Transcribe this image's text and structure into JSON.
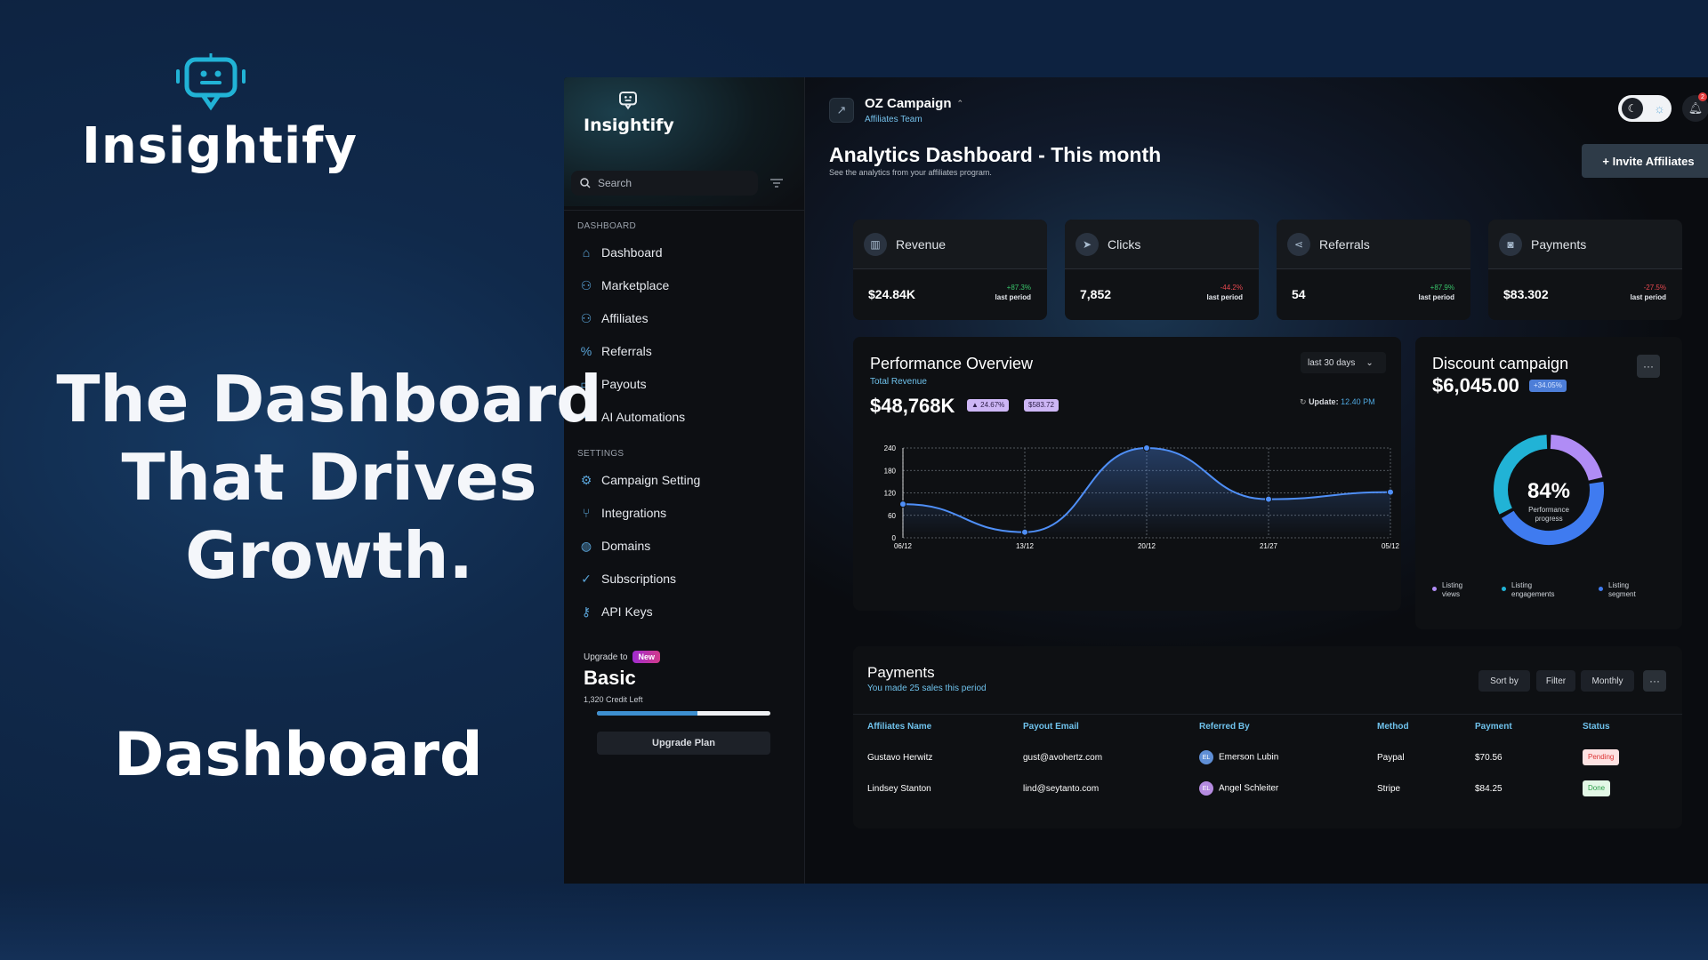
{
  "marketing": {
    "brand_name": "Insightify",
    "headline_line1": "The Dashboard",
    "headline_line2": "That Drives Growth.",
    "subtitle": "Dashboard"
  },
  "colors": {
    "accent": "#4f8ff7",
    "teal": "#21b3d6",
    "purple": "#b08cf5",
    "positive": "#39c46a",
    "negative": "#e8484f"
  },
  "sidebar": {
    "logo_name": "Insightify",
    "search_placeholder": "Search",
    "section_dashboard": "DASHBOARD",
    "section_settings": "SETTINGS",
    "items": [
      {
        "label": "Dashboard",
        "icon": "home-icon"
      },
      {
        "label": "Marketplace",
        "icon": "users-icon"
      },
      {
        "label": "Affiliates",
        "icon": "users-icon"
      },
      {
        "label": "Referrals",
        "icon": "percent-icon"
      },
      {
        "label": "Payouts",
        "icon": "card-icon"
      },
      {
        "label": "AI Automations",
        "icon": "sparkle-icon"
      }
    ],
    "settings_items": [
      {
        "label": "Campaign Setting",
        "icon": "gear-icon"
      },
      {
        "label": "Integrations",
        "icon": "branch-icon"
      },
      {
        "label": "Domains",
        "icon": "globe-icon"
      },
      {
        "label": "Subscriptions",
        "icon": "check-circle-icon"
      },
      {
        "label": "API Keys",
        "icon": "key-icon"
      }
    ],
    "upgrade": {
      "upgrade_to": "Upgrade to",
      "badge": "New",
      "plan": "Basic",
      "credit": "1,320 Credit Left",
      "progress": 0.58,
      "button": "Upgrade Plan"
    }
  },
  "header": {
    "campaign": "OZ Campaign",
    "team": "Affiliates Team",
    "notification_count": "2",
    "title": "Analytics Dashboard - This month",
    "subtitle": "See the analytics from your affiliates program.",
    "invite": "+ Invite Affiliates"
  },
  "stats": [
    {
      "label": "Revenue",
      "value": "$24.84K",
      "change": "+87.3%",
      "period": "last period",
      "positive": true,
      "icon": "chart-icon"
    },
    {
      "label": "Clicks",
      "value": "7,852",
      "change": "-44.2%",
      "period": "last period",
      "positive": false,
      "icon": "cursor-icon"
    },
    {
      "label": "Referrals",
      "value": "54",
      "change": "+87.9%",
      "period": "last period",
      "positive": true,
      "icon": "share-icon"
    },
    {
      "label": "Payments",
      "value": "$83.302",
      "change": "-27.5%",
      "period": "last period",
      "positive": false,
      "icon": "money-icon"
    }
  ],
  "performance": {
    "title": "Performance Overview",
    "subtitle": "Total Revenue",
    "value": "$48,768K",
    "pill1": "▲ 24.67%",
    "pill2": "$583.72",
    "range": "last 30 days",
    "update_label": "Update:",
    "update_time": "12.40 PM"
  },
  "chart_data": {
    "type": "line",
    "x": [
      "06/12",
      "13/12",
      "20/12",
      "21/27",
      "05/12"
    ],
    "values": [
      90,
      15,
      240,
      103,
      122
    ],
    "yticks": [
      0,
      60,
      120,
      180,
      240
    ],
    "ylim": [
      0,
      240
    ],
    "grid": true
  },
  "discount": {
    "title": "Discount campaign",
    "value": "$6,045.00",
    "pill": "+34.05%",
    "percent": "84%",
    "percent_label1": "Performance",
    "percent_label2": "progress",
    "segments": [
      {
        "name": "Listing views",
        "value": 0.22,
        "color": "#b08cf5"
      },
      {
        "name": "Listing engagements",
        "value": 0.45,
        "color": "#3f7bf0"
      },
      {
        "name": "Listing segment",
        "value": 0.33,
        "color": "#21b3d6"
      }
    ],
    "legend": [
      {
        "line1": "Listing",
        "line2": "views",
        "color": "#b08cf5"
      },
      {
        "line1": "Listing",
        "line2": "engagements",
        "color": "#21b3d6"
      },
      {
        "line1": "Listing",
        "line2": "segment",
        "color": "#3f7bf0"
      }
    ]
  },
  "payments": {
    "title": "Payments",
    "subtitle": "You made 25 sales this period",
    "sort": "Sort by",
    "filter": "Filter",
    "monthly": "Monthly",
    "columns": [
      "Affiliates Name",
      "Payout Email",
      "Referred By",
      "Method",
      "Payment",
      "Status"
    ],
    "rows": [
      {
        "name": "Gustavo Herwitz",
        "email": "gust@avohertz.com",
        "ref_initials": "EL",
        "ref": "Emerson Lubin",
        "method": "Paypal",
        "payment": "$70.56",
        "status": "Pending"
      },
      {
        "name": "Lindsey Stanton",
        "email": "lind@seytanto.com",
        "ref_initials": "EL",
        "ref": "Angel Schleiter",
        "method": "Stripe",
        "payment": "$84.25",
        "status": "Done"
      }
    ]
  }
}
